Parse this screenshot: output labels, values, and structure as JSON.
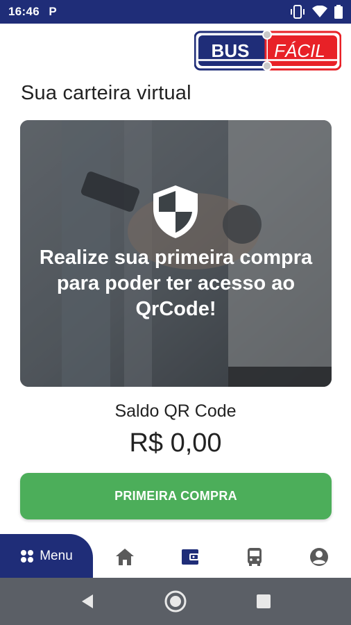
{
  "status_bar": {
    "time": "16:46",
    "notification_icon": "P"
  },
  "logo": {
    "left_text": "BUS",
    "right_text": "FÁCIL"
  },
  "page": {
    "title": "Sua carteira virtual"
  },
  "hero": {
    "message": "Realize sua primeira compra para poder ter acesso ao QrCode!",
    "icon": "shield-icon"
  },
  "balance": {
    "label": "Saldo QR Code",
    "value": "R$ 0,00"
  },
  "actions": {
    "primary_label": "PRIMEIRA COMPRA"
  },
  "bottom_nav": {
    "menu_label": "Menu",
    "items": [
      "home-icon",
      "wallet-icon",
      "bus-icon",
      "account-icon"
    ]
  },
  "colors": {
    "brand_blue": "#1f2d78",
    "brand_red": "#e82127",
    "button_green": "#4cae5a"
  }
}
